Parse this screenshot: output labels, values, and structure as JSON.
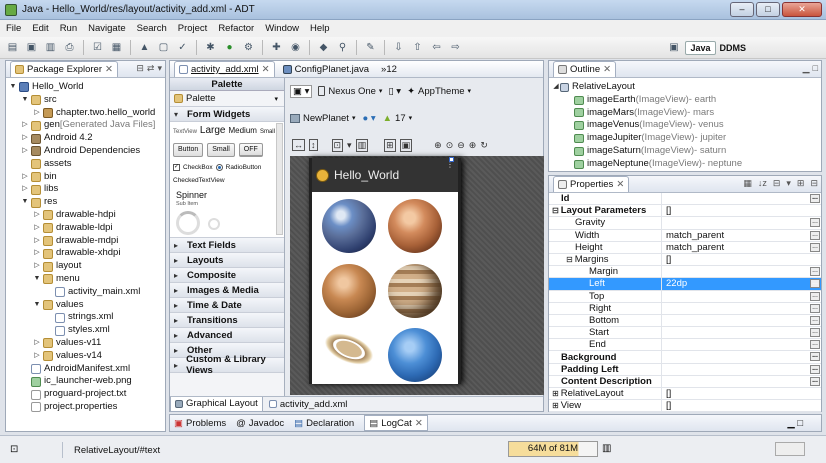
{
  "window": {
    "title": "Java - Hello_World/res/layout/activity_add.xml - ADT"
  },
  "menu": [
    "File",
    "Edit",
    "Run",
    "Navigate",
    "Search",
    "Project",
    "Refactor",
    "Window",
    "Help"
  ],
  "perspectives": {
    "java": "Java",
    "ddms": "DDMS"
  },
  "package_explorer": {
    "title": "Package Explorer",
    "items": [
      {
        "label": "Hello_World",
        "depth": 0,
        "tw": "▼",
        "icon": "project-icon"
      },
      {
        "label": "src",
        "depth": 1,
        "tw": "▼",
        "icon": "folder-icon"
      },
      {
        "label": "chapter.two.hello_world",
        "depth": 2,
        "tw": "▷",
        "icon": "package-icon"
      },
      {
        "label": "gen",
        "extra": " [Generated Java Files]",
        "depth": 1,
        "tw": "▷",
        "icon": "folder-icon"
      },
      {
        "label": "Android 4.2",
        "depth": 1,
        "tw": "▷",
        "icon": "jar-icon"
      },
      {
        "label": "Android Dependencies",
        "depth": 1,
        "tw": "▷",
        "icon": "jar-icon"
      },
      {
        "label": "assets",
        "depth": 1,
        "tw": "",
        "icon": "folder-icon"
      },
      {
        "label": "bin",
        "depth": 1,
        "tw": "▷",
        "icon": "folder-icon"
      },
      {
        "label": "libs",
        "depth": 1,
        "tw": "▷",
        "icon": "folder-icon"
      },
      {
        "label": "res",
        "depth": 1,
        "tw": "▼",
        "icon": "folder-icon"
      },
      {
        "label": "drawable-hdpi",
        "depth": 2,
        "tw": "▷",
        "icon": "folder-icon"
      },
      {
        "label": "drawable-ldpi",
        "depth": 2,
        "tw": "▷",
        "icon": "folder-icon"
      },
      {
        "label": "drawable-mdpi",
        "depth": 2,
        "tw": "▷",
        "icon": "folder-icon"
      },
      {
        "label": "drawable-xhdpi",
        "depth": 2,
        "tw": "▷",
        "icon": "folder-icon"
      },
      {
        "label": "layout",
        "depth": 2,
        "tw": "▷",
        "icon": "folder-icon"
      },
      {
        "label": "menu",
        "depth": 2,
        "tw": "▼",
        "icon": "folder-icon"
      },
      {
        "label": "activity_main.xml",
        "depth": 3,
        "tw": "",
        "icon": "xml-icon"
      },
      {
        "label": "values",
        "depth": 2,
        "tw": "▼",
        "icon": "folder-icon"
      },
      {
        "label": "strings.xml",
        "depth": 3,
        "tw": "",
        "icon": "xml-icon"
      },
      {
        "label": "styles.xml",
        "depth": 3,
        "tw": "",
        "icon": "xml-icon"
      },
      {
        "label": "values-v11",
        "depth": 2,
        "tw": "▷",
        "icon": "folder-icon"
      },
      {
        "label": "values-v14",
        "depth": 2,
        "tw": "▷",
        "icon": "folder-icon"
      },
      {
        "label": "AndroidManifest.xml",
        "depth": 1,
        "tw": "",
        "icon": "xml-icon"
      },
      {
        "label": "ic_launcher-web.png",
        "depth": 1,
        "tw": "",
        "icon": "image-icon"
      },
      {
        "label": "proguard-project.txt",
        "depth": 1,
        "tw": "",
        "icon": "text-file-icon"
      },
      {
        "label": "project.properties",
        "depth": 1,
        "tw": "",
        "icon": "text-file-icon"
      }
    ]
  },
  "editor": {
    "tabs": [
      {
        "label": "activity_add.xml",
        "active": true
      },
      {
        "label": "ConfigPlanet.java",
        "active": false
      },
      {
        "label": "»12",
        "active": false
      }
    ],
    "palette": {
      "header": "Palette",
      "dropdown": "Palette",
      "open_section": "Form Widgets",
      "textview_row": {
        "small_label": "TextView",
        "large": "Large",
        "medium": "Medium",
        "small": "Small"
      },
      "buttons": [
        "Button",
        "Small",
        "OFF"
      ],
      "checkbox": "CheckBox",
      "radio": "RadioButton",
      "checked_text": "CheckedTextView",
      "spinner": "Spinner",
      "spinner_sub": "Sub Item",
      "sections": [
        "Text Fields",
        "Layouts",
        "Composite",
        "Images & Media",
        "Time & Date",
        "Transitions",
        "Advanced",
        "Other",
        "Custom & Library Views"
      ]
    },
    "device": "Nexus One",
    "theme": "AppTheme",
    "activity": "NewPlanet",
    "api": "17",
    "app_title": "Hello_World",
    "bottom_tabs": [
      "Graphical Layout",
      "activity_add.xml"
    ]
  },
  "outline": {
    "title": "Outline",
    "root": "RelativeLayout",
    "items": [
      {
        "name": "imageEarth",
        "type": " (ImageView)",
        "desc": " - earth"
      },
      {
        "name": "imageMars",
        "type": " (ImageView)",
        "desc": " - mars"
      },
      {
        "name": "imageVenus",
        "type": " (ImageView)",
        "desc": " - venus"
      },
      {
        "name": "imageJupiter",
        "type": " (ImageView)",
        "desc": " - jupiter"
      },
      {
        "name": "imageSaturn",
        "type": " (ImageView)",
        "desc": " - saturn"
      },
      {
        "name": "imageNeptune",
        "type": " (ImageView)",
        "desc": " - neptune"
      }
    ]
  },
  "properties": {
    "title": "Properties",
    "rows": [
      {
        "key": "Id",
        "value": "",
        "bold": true,
        "indent": 0,
        "tw": "",
        "dots": true,
        "selected": false
      },
      {
        "key": "Layout Parameters",
        "value": "[]",
        "bold": true,
        "indent": 0,
        "tw": "⊟",
        "dots": false,
        "selected": false
      },
      {
        "key": "Gravity",
        "value": "",
        "bold": false,
        "indent": 1,
        "tw": "",
        "dots": true,
        "selected": false
      },
      {
        "key": "Width",
        "value": "match_parent",
        "bold": false,
        "indent": 1,
        "tw": "",
        "dots": true,
        "selected": false
      },
      {
        "key": "Height",
        "value": "match_parent",
        "bold": false,
        "indent": 1,
        "tw": "",
        "dots": true,
        "selected": false
      },
      {
        "key": "Margins",
        "value": "[]",
        "bold": false,
        "indent": 1,
        "tw": "⊟",
        "dots": false,
        "selected": false
      },
      {
        "key": "Margin",
        "value": "",
        "bold": false,
        "indent": 2,
        "tw": "",
        "dots": true,
        "selected": false
      },
      {
        "key": "Left",
        "value": "22dp",
        "bold": false,
        "indent": 2,
        "tw": "",
        "dots": true,
        "selected": true
      },
      {
        "key": "Top",
        "value": "",
        "bold": false,
        "indent": 2,
        "tw": "",
        "dots": true,
        "selected": false
      },
      {
        "key": "Right",
        "value": "",
        "bold": false,
        "indent": 2,
        "tw": "",
        "dots": true,
        "selected": false
      },
      {
        "key": "Bottom",
        "value": "",
        "bold": false,
        "indent": 2,
        "tw": "",
        "dots": true,
        "selected": false
      },
      {
        "key": "Start",
        "value": "",
        "bold": false,
        "indent": 2,
        "tw": "",
        "dots": true,
        "selected": false
      },
      {
        "key": "End",
        "value": "",
        "bold": false,
        "indent": 2,
        "tw": "",
        "dots": true,
        "selected": false
      },
      {
        "key": "Background",
        "value": "",
        "bold": true,
        "indent": 0,
        "tw": "",
        "dots": true,
        "selected": false
      },
      {
        "key": "Padding Left",
        "value": "",
        "bold": true,
        "indent": 0,
        "tw": "",
        "dots": true,
        "selected": false
      },
      {
        "key": "Content Description",
        "value": "",
        "bold": true,
        "indent": 0,
        "tw": "",
        "dots": true,
        "selected": false
      },
      {
        "key": "RelativeLayout",
        "value": "[]",
        "bold": false,
        "indent": 0,
        "tw": "⊞",
        "dots": false,
        "selected": false
      },
      {
        "key": "View",
        "value": "[]",
        "bold": false,
        "indent": 0,
        "tw": "⊞",
        "dots": false,
        "selected": false
      }
    ]
  },
  "bottom_panel": {
    "tabs": [
      "Problems",
      "Javadoc",
      "Declaration",
      "LogCat"
    ]
  },
  "status": {
    "path": "RelativeLayout/#text",
    "memory": "64M of 81M"
  },
  "colors": {
    "selection": "#3399ff",
    "app_bar": "#333333",
    "canvas": "#555555"
  }
}
